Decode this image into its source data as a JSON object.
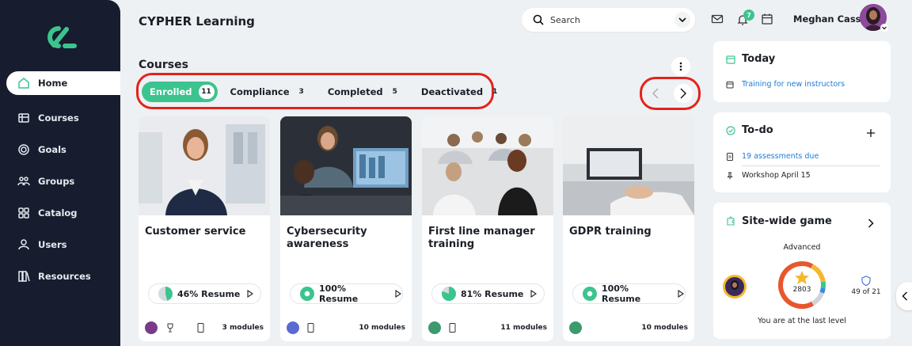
{
  "app": {
    "title": "CYPHER Learning"
  },
  "sidebar": {
    "items": [
      {
        "label": "Home",
        "icon": "home-icon"
      },
      {
        "label": "Courses",
        "icon": "courses-icon"
      },
      {
        "label": "Goals",
        "icon": "target-icon"
      },
      {
        "label": "Groups",
        "icon": "groups-icon"
      },
      {
        "label": "Catalog",
        "icon": "catalog-icon"
      },
      {
        "label": "Users",
        "icon": "user-icon"
      },
      {
        "label": "Resources",
        "icon": "resources-icon"
      }
    ]
  },
  "header": {
    "search_placeholder": "Search",
    "notification_count": "7",
    "user_name": "Meghan Cass"
  },
  "courses": {
    "title": "Courses",
    "tabs": [
      {
        "label": "Enrolled",
        "count": "11"
      },
      {
        "label": "Compliance",
        "count": "3"
      },
      {
        "label": "Completed",
        "count": "5"
      },
      {
        "label": "Deactivated",
        "count": "1"
      }
    ],
    "cards": [
      {
        "title": "Customer service",
        "progress_label": "46% Resume",
        "progress": 46,
        "modules": "3 modules"
      },
      {
        "title": "Cybersecurity awareness",
        "progress_label": "100% Resume",
        "progress": 100,
        "modules": "10 modules"
      },
      {
        "title": "First line manager training",
        "progress_label": "81% Resume",
        "progress": 81,
        "modules": "11 modules"
      },
      {
        "title": "GDPR training",
        "progress_label": "100% Resume",
        "progress": 100,
        "modules": "10 modules"
      }
    ]
  },
  "today": {
    "title": "Today",
    "items": [
      {
        "label": "Training for new instructors"
      }
    ]
  },
  "todo": {
    "title": "To-do",
    "items": [
      {
        "label": "19 assessments due"
      },
      {
        "label": "Workshop April 15"
      }
    ]
  },
  "game": {
    "title": "Site-wide game",
    "level": "Advanced",
    "points": "2803",
    "rank": "49 of 21",
    "footer": "You are at the last level"
  },
  "colors": {
    "accent": "#3bc48e",
    "sidebar": "#171c2e",
    "highlight": "#e3231b",
    "link": "#1e7bd6"
  }
}
